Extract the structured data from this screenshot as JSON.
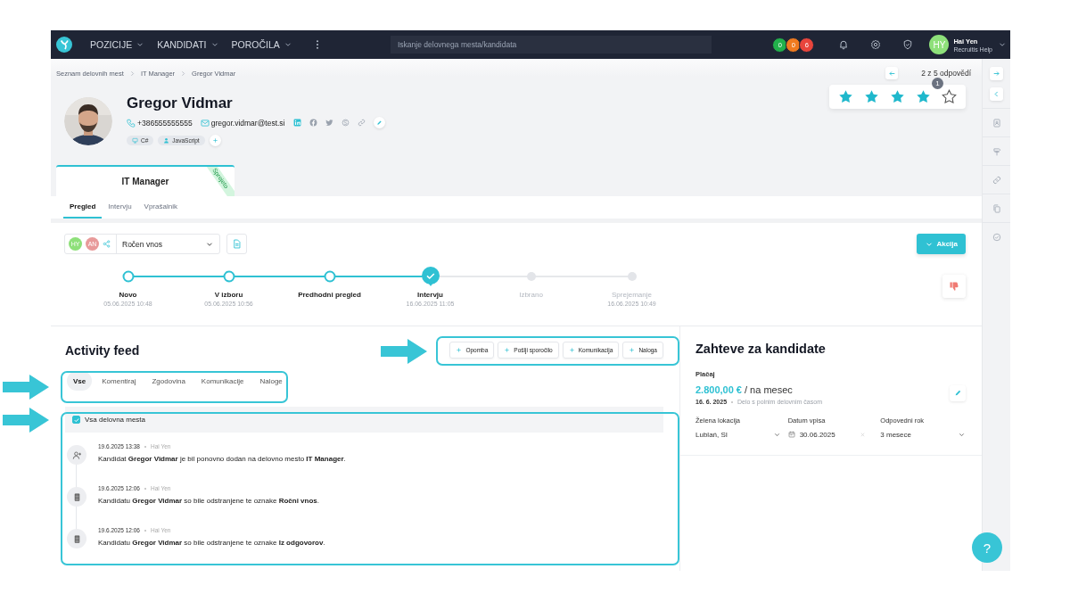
{
  "topbar": {
    "nav": [
      {
        "label": "POZICIJE"
      },
      {
        "label": "KANDIDATI"
      },
      {
        "label": "POROČILA"
      }
    ],
    "search": {
      "placeholder": "Iskanje delovnega mesta/kandidata"
    },
    "counters": [
      {
        "value": "0",
        "color": "#22b04b"
      },
      {
        "value": "0",
        "color": "#f07a1f"
      },
      {
        "value": "6",
        "color": "#e8453c"
      }
    ],
    "user": {
      "initials": "HY",
      "name": "Hai Yen",
      "company": "Recruitis Help"
    }
  },
  "breadcrumbs": [
    "Seznam delovnih mest",
    "IT Manager",
    "Gregor Vidmar"
  ],
  "pager": {
    "text": "2 z 5 odpovědí"
  },
  "candidate": {
    "name": "Gregor Vidmar",
    "phone": "+386555555555",
    "email": "gregor.vidmar@test.si",
    "skills": [
      {
        "label": "C#",
        "kind": "computer"
      },
      {
        "label": "JavaScript",
        "kind": "person"
      }
    ]
  },
  "rating": {
    "stars": 4,
    "badge": "1"
  },
  "job_card": {
    "title": "IT Manager",
    "status": "Sprejeto"
  },
  "tabs": [
    {
      "label": "Pregled",
      "selected": true
    },
    {
      "label": "Intervju",
      "selected": false
    },
    {
      "label": "Vprašalnik",
      "selected": false
    }
  ],
  "toolbar": {
    "assignees": [
      {
        "initials": "HY",
        "color": "#8ee07a"
      },
      {
        "initials": "AN",
        "color": "#e89a9a"
      }
    ],
    "source": "Ročen vnos",
    "action": "Akcija"
  },
  "steps": [
    {
      "label": "Novo",
      "date": "05.06.2025 10:48",
      "completed": true,
      "current": false
    },
    {
      "label": "V izboru",
      "date": "05.06.2025 10:56",
      "completed": true,
      "current": false
    },
    {
      "label": "Predhodni pregled",
      "completed": true,
      "current": false
    },
    {
      "label": "Intervju",
      "date": "16.06.2025 11:05",
      "completed": true,
      "current": true
    },
    {
      "label": "Izbrano",
      "completed": false,
      "current": false
    },
    {
      "label": "Sprejemanje",
      "date": "16.06.2025 10:49",
      "completed": false,
      "current": false
    }
  ],
  "activity": {
    "title": "Activity feed",
    "actions": [
      "Opomba",
      "Pošlji sporočilo",
      "Komunikacija",
      "Naloga"
    ],
    "filters": [
      {
        "label": "Vse",
        "selected": true
      },
      {
        "label": "Komentiraj",
        "selected": false
      },
      {
        "label": "Zgodovina",
        "selected": false
      },
      {
        "label": "Komunikacije",
        "selected": false
      },
      {
        "label": "Naloge",
        "selected": false
      }
    ],
    "all_positions": {
      "label": "Vsa delovna mesta",
      "checked": true
    },
    "items": [
      {
        "kind": "added",
        "time": "19.6.2025 13:38",
        "author": "Hai Yen",
        "text": "Kandidat **Gregor Vidmar** je bil ponovno dodan na delovno mesto **IT Manager**."
      },
      {
        "kind": "tags",
        "time": "19.6.2025 12:06",
        "author": "Hai Yen",
        "text": "Kandidatu **Gregor Vidmar** so bile odstranjene te oznake **Ročni vnos**."
      },
      {
        "kind": "tags",
        "time": "19.6.2025 12:06",
        "author": "Hai Yen",
        "text": "Kandidatu **Gregor Vidmar** so bile odstranjene te oznake **Iz odgovorov**."
      }
    ]
  },
  "requirements": {
    "title": "Zahteve za kandidate",
    "salary": {
      "label": "Plačaj",
      "amount": "2.800,00 €",
      "unit": "/ na mesec",
      "date": "16. 6. 2025",
      "type": "Delo s polnim delovnim časom"
    },
    "fields": [
      {
        "label": "Želena lokacija",
        "value": "Lublań, SI",
        "kind": "select"
      },
      {
        "label": "Datum vpisa",
        "value": "30.06.2025",
        "kind": "date"
      },
      {
        "label": "Odpovedni rok",
        "value": "3 mesece",
        "kind": "select"
      }
    ]
  },
  "help": "?",
  "highlights": {
    "actions": true,
    "filters": true,
    "feed": true
  }
}
